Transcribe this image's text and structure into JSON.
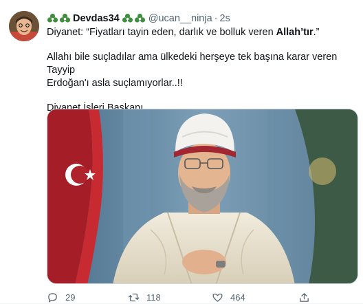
{
  "tweet": {
    "display_name": "Devdas34",
    "handle": "@ucan__ninja",
    "separator": "·",
    "time": "2s",
    "avatar_icon": "child-portrait-avatar",
    "name_emoji_icon": "recycle-emoji-icon",
    "text": {
      "line1_prefix": "Diyanet: “Fiyatları tayin eden, darlık ve bolluk veren ",
      "line1_bold": "Allah’tır",
      "line1_suffix": ".”",
      "para2_line1": "Allahı bile suçladılar ama ülkedeki herşeye tek başına karar veren Tayyip",
      "para2_line2": "Erdoğan'ı  asla suçlamıyorlar..!!",
      "para3": "Diyanet İşleri Başkanı"
    },
    "media_icon": "photo-of-cleric-with-flags",
    "actions": {
      "reply_count": "29",
      "retweet_count": "118",
      "like_count": "464"
    }
  },
  "colors": {
    "text": "#0f1419",
    "secondary": "#536471",
    "border": "#cfd9de",
    "emoji_green": "#3f8f3f"
  }
}
